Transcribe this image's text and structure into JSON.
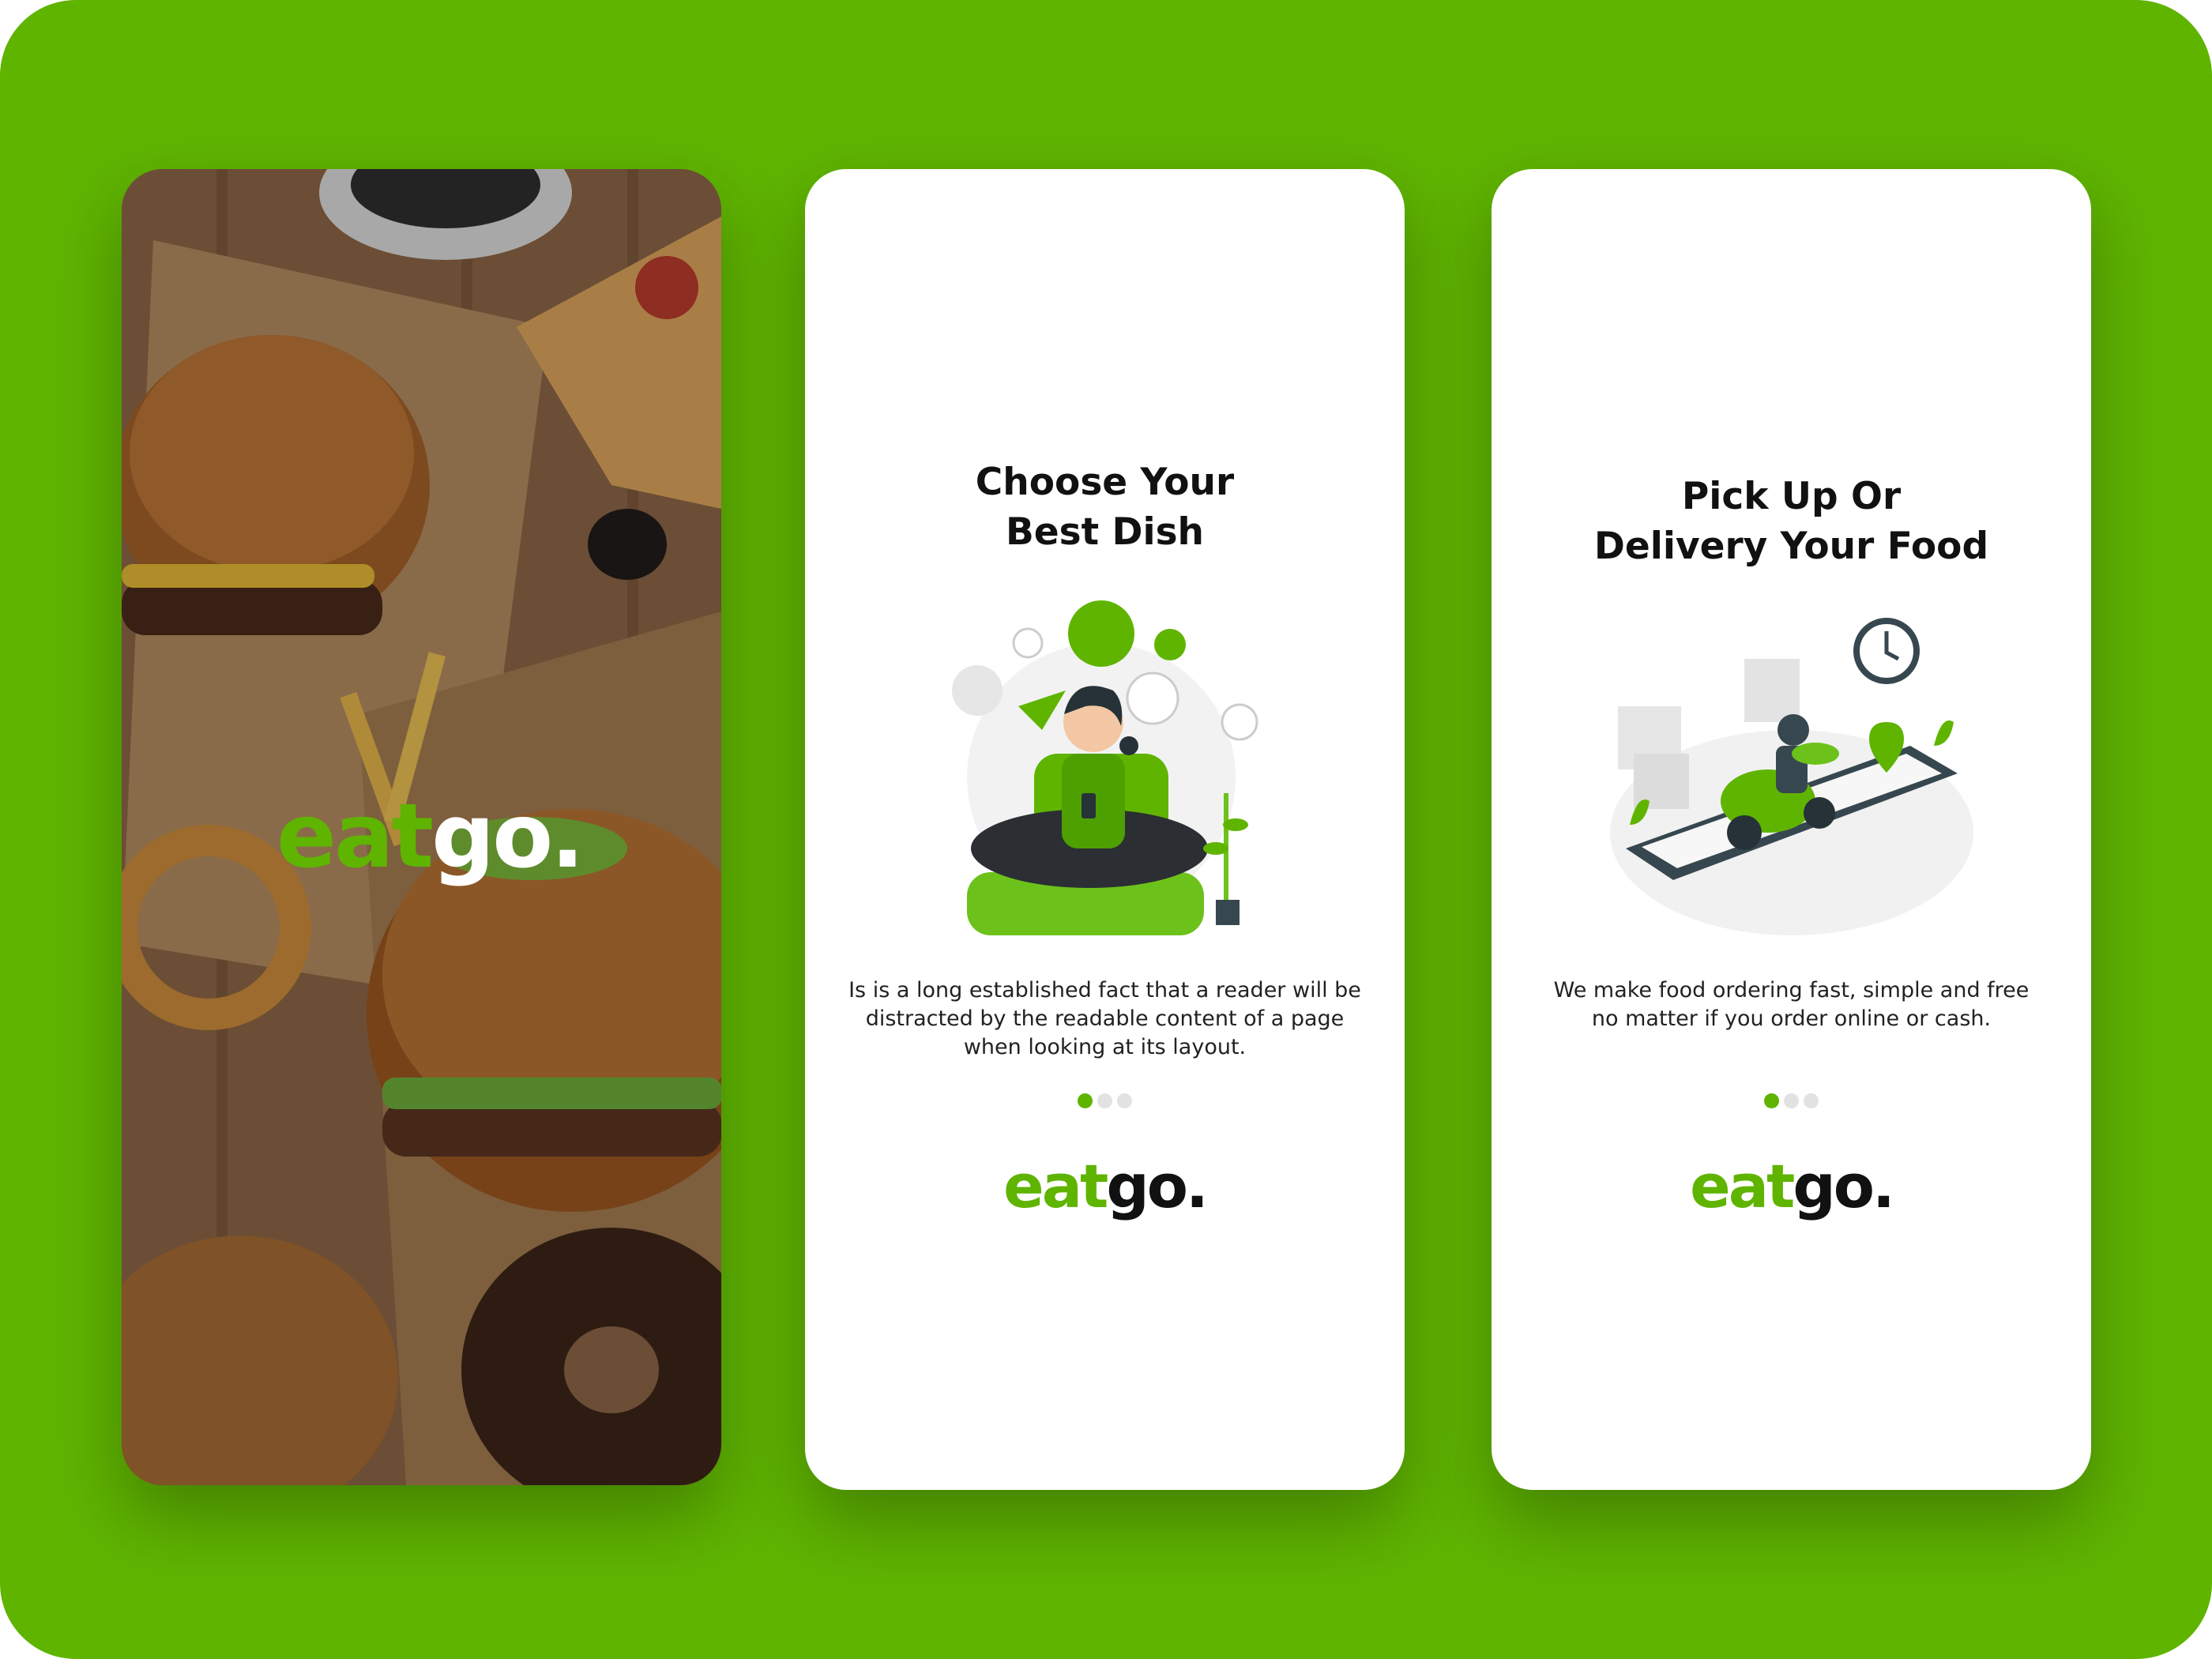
{
  "colors": {
    "background": "#5fb400",
    "accent": "#5fb400",
    "text": "#111111"
  },
  "logo": {
    "part1": "eat",
    "part2": "go."
  },
  "screens": [
    {
      "id": "splash"
    },
    {
      "id": "onboarding-1",
      "title": "Choose Your\nBest Dish",
      "description": "Is is a long established fact that a reader will be\ndistracted by the readable content of a page\nwhen looking at its layout.",
      "pager": {
        "total": 3,
        "active": 1
      }
    },
    {
      "id": "onboarding-2",
      "title": "Pick Up Or\nDelivery Your Food",
      "description": "We make food ordering fast, simple and free\nno matter if you order online or cash.",
      "pager": {
        "total": 3,
        "active": 1
      }
    }
  ]
}
